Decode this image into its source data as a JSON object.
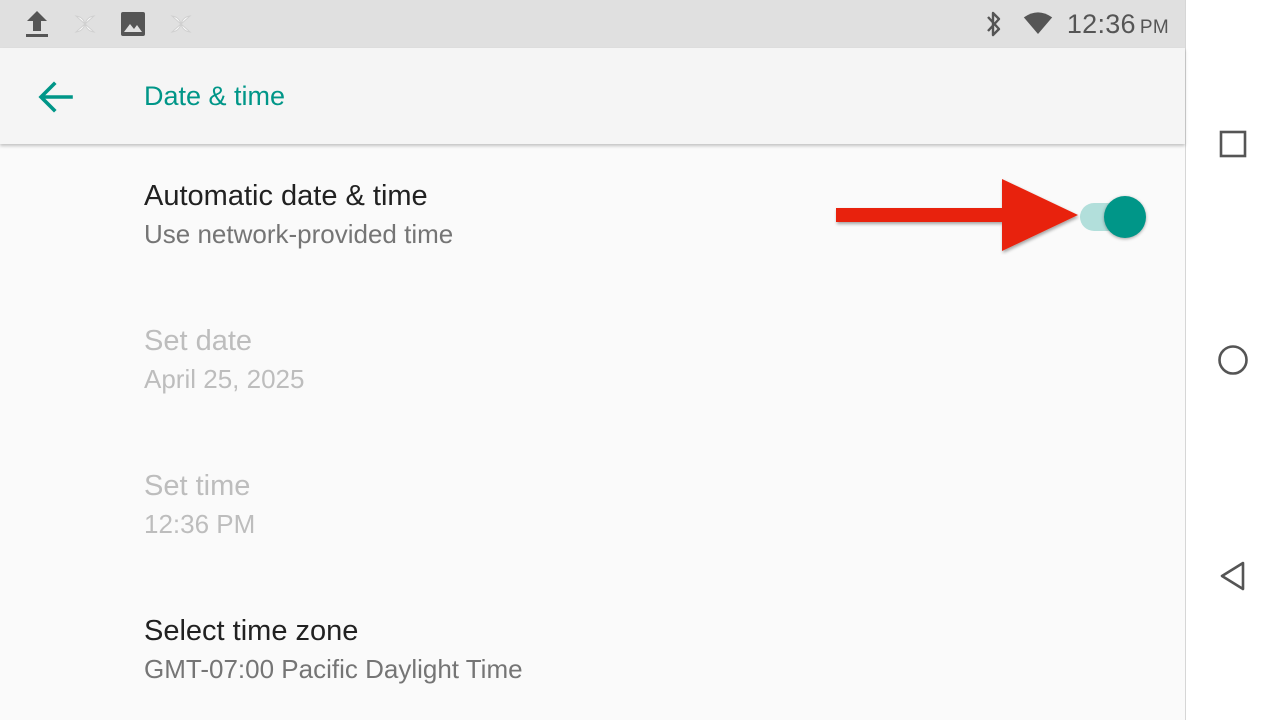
{
  "status_bar": {
    "time": "12:36",
    "ampm": "PM",
    "left_icons": [
      "upload-icon",
      "pinwheel-icon",
      "image-icon",
      "pinwheel-icon"
    ],
    "right_icons": [
      "bluetooth-icon",
      "wifi-icon"
    ]
  },
  "app_bar": {
    "title": "Date & time",
    "back_icon": "arrow-left-icon"
  },
  "preferences": [
    {
      "title": "Automatic date & time",
      "subtitle": "Use network-provided time",
      "enabled": true,
      "switch_on": true
    },
    {
      "title": "Set date",
      "subtitle": "April 25, 2025",
      "enabled": false
    },
    {
      "title": "Set time",
      "subtitle": "12:36 PM",
      "enabled": false
    },
    {
      "title": "Select time zone",
      "subtitle": "GMT-07:00 Pacific Daylight Time",
      "enabled": true
    }
  ],
  "nav_bar": {
    "buttons": [
      "recents-icon",
      "home-icon",
      "back-icon"
    ]
  },
  "colors": {
    "accent": "#009688",
    "switch_track": "#b2dfdb",
    "annotation_arrow": "#e8210a",
    "status_bar_bg": "#e0e0e0",
    "disabled_text": "#bdbdbd"
  }
}
